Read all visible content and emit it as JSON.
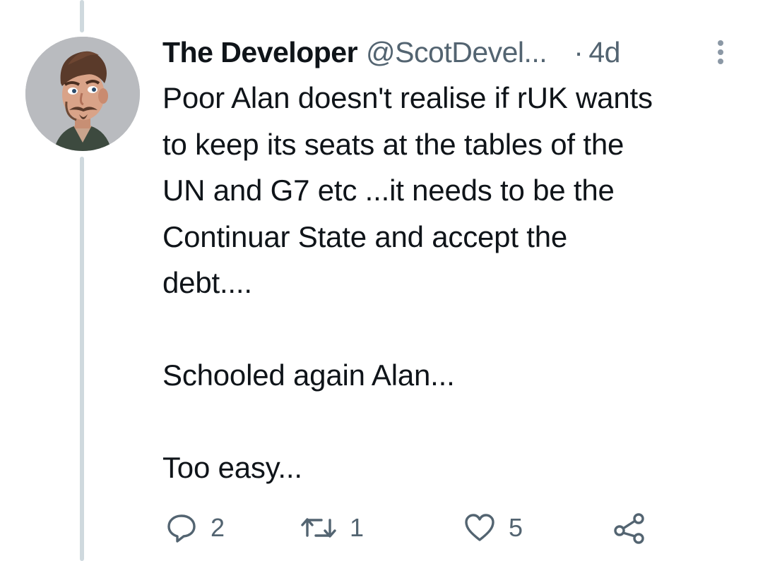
{
  "tweet": {
    "author": {
      "display_name": "The Developer",
      "handle": "@ScotDevel...",
      "avatar_icon": "cartoon-man-avatar"
    },
    "separator": "·",
    "time": "4d",
    "more_icon": "more-vertical-icon",
    "text": "Poor Alan doesn't realise if rUK wants\nto keep its seats at the tables of the\nUN and G7 etc ...it needs to be the\nContinuar State and accept the\ndebt....\n\nSchooled again Alan...\n\nToo easy...",
    "actions": {
      "replies": "2",
      "retweets": "1",
      "likes": "5",
      "reply_icon": "reply-icon",
      "retweet_icon": "retweet-icon",
      "like_icon": "heart-icon",
      "share_icon": "share-icon"
    }
  },
  "colors": {
    "text_primary": "#0f1419",
    "text_secondary": "#536471",
    "thread_line": "#cfd9de",
    "background": "#ffffff"
  }
}
